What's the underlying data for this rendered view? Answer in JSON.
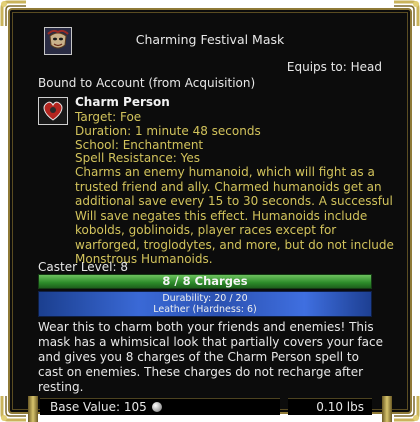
{
  "item": {
    "title": "Charming Festival Mask",
    "equips_to": "Equips to: Head",
    "binding": "Bound to Account (from Acquisition)"
  },
  "spell": {
    "name": "Charm Person",
    "target": "Target: Foe",
    "duration": "Duration: 1 minute 48 seconds",
    "school": "School: Enchantment",
    "resistance": "Spell Resistance: Yes",
    "description": "Charms an enemy humanoid, which will fight as a trusted friend and ally. Charmed humanoids get an additional save every 15 to 30 seconds. A successful Will save negates this effect. Humanoids include kobolds, goblinoids, player races except for warforged, troglodytes, and more, but do not include Monstrous Humanoids."
  },
  "caster_level": "Caster Level: 8",
  "charges": {
    "label": "8 / 8 Charges",
    "current": 8,
    "max": 8
  },
  "durability": {
    "label": "Durability: 20 / 20",
    "material": "Leather (Hardness: 6)",
    "current": 20,
    "max": 20
  },
  "description": "Wear this to charm both your friends and enemies! This mask has a whimsical look that partially covers your face and gives you 8 charges of the Charm Person spell to cast on enemies. These charges do not recharge after resting.",
  "footer": {
    "base_value": "Base Value: 105",
    "weight": "0.10 lbs"
  },
  "icons": {
    "item": "mask-icon",
    "spell": "charm-heart-icon",
    "currency": "silver-coin-icon"
  },
  "colors": {
    "background": "#0c0c0c",
    "border_gold": "#8f7a37",
    "spell_text": "#d2c35c",
    "text": "#e8e8e8",
    "charges_bar": "#2c8a29",
    "durability_bar": "#3a69d6"
  }
}
